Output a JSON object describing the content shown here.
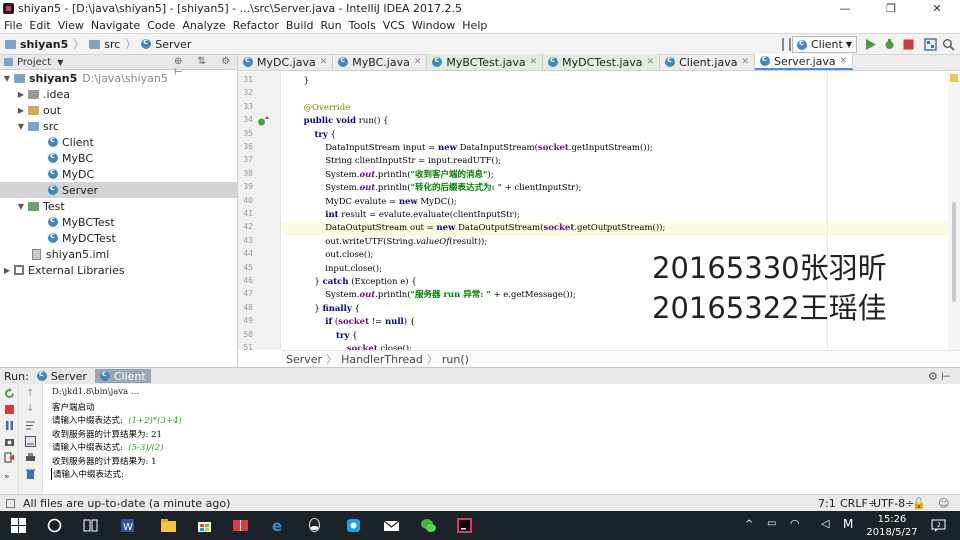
{
  "window": {
    "title": "shiyan5 - [D:\\java\\shiyan5] - [shiyan5] - ...\\src\\Server.java - IntelliJ IDEA 2017.2.5"
  },
  "menu": [
    "File",
    "Edit",
    "View",
    "Navigate",
    "Code",
    "Analyze",
    "Refactor",
    "Build",
    "Run",
    "Tools",
    "VCS",
    "Window",
    "Help"
  ],
  "nav": {
    "project": "shiyan5",
    "folder": "src",
    "file": "Server",
    "run_config": "Client"
  },
  "project_panel": {
    "header": "Project",
    "tree": [
      {
        "label": "shiyan5",
        "path": "D:\\java\\shiyan5",
        "icon": "folder-icon"
      },
      {
        "label": ".idea",
        "icon": "folder-icon"
      },
      {
        "label": "out",
        "icon": "folder-icon"
      },
      {
        "label": "src",
        "icon": "folder-icon"
      },
      {
        "label": "Client",
        "icon": "class-icon"
      },
      {
        "label": "MyBC",
        "icon": "class-icon"
      },
      {
        "label": "MyDC",
        "icon": "class-icon"
      },
      {
        "label": "Server",
        "icon": "class-icon"
      },
      {
        "label": "Test",
        "icon": "folder-icon"
      },
      {
        "label": "MyBCTest",
        "icon": "class-icon"
      },
      {
        "label": "MyDCTest",
        "icon": "class-icon"
      },
      {
        "label": "shiyan5.iml",
        "icon": "file-icon"
      },
      {
        "label": "External Libraries",
        "icon": "library-icon"
      }
    ]
  },
  "tabs": [
    {
      "label": "MyDC.java"
    },
    {
      "label": "MyBC.java"
    },
    {
      "label": "MyBCTest.java"
    },
    {
      "label": "MyDCTest.java"
    },
    {
      "label": "Client.java"
    },
    {
      "label": "Server.java"
    }
  ],
  "editor": {
    "line_numbers": [
      "31",
      "32",
      "33",
      "34",
      "35",
      "36",
      "37",
      "38",
      "39",
      "40",
      "41",
      "42",
      "43",
      "44",
      "45",
      "46",
      "47",
      "48",
      "49",
      "50",
      "51"
    ],
    "breadcrumb": [
      "Server",
      "HandlerThread",
      "run()"
    ]
  },
  "overlay": {
    "line1": "20165330张羽昕",
    "line2": "20165322王瑶佳"
  },
  "run_panel": {
    "label": "Run:",
    "tabs": [
      "Server",
      "Client"
    ],
    "console": [
      {
        "text": "D:\\jkd1.8\\bin\\java ..."
      },
      {
        "text": "客户端启动"
      },
      {
        "text": "请输入中缀表达式:  ",
        "input": "(1+2)*(3+4)"
      },
      {
        "text": "收到服务器的计算结果为: 21"
      },
      {
        "text": "请输入中缀表达式:  ",
        "input": "(5-3)/(2)"
      },
      {
        "text": "收到服务器的计算结果为: 1"
      },
      {
        "text": "请输入中缀表达式:"
      }
    ]
  },
  "status": {
    "message": "All files are up-to-date (a minute ago)",
    "position": "7:1",
    "line_sep": "CRLF÷",
    "encoding": "UTF-8÷"
  },
  "taskbar": {
    "time": "15:26",
    "date": "2018/5/27",
    "ime": "M"
  }
}
